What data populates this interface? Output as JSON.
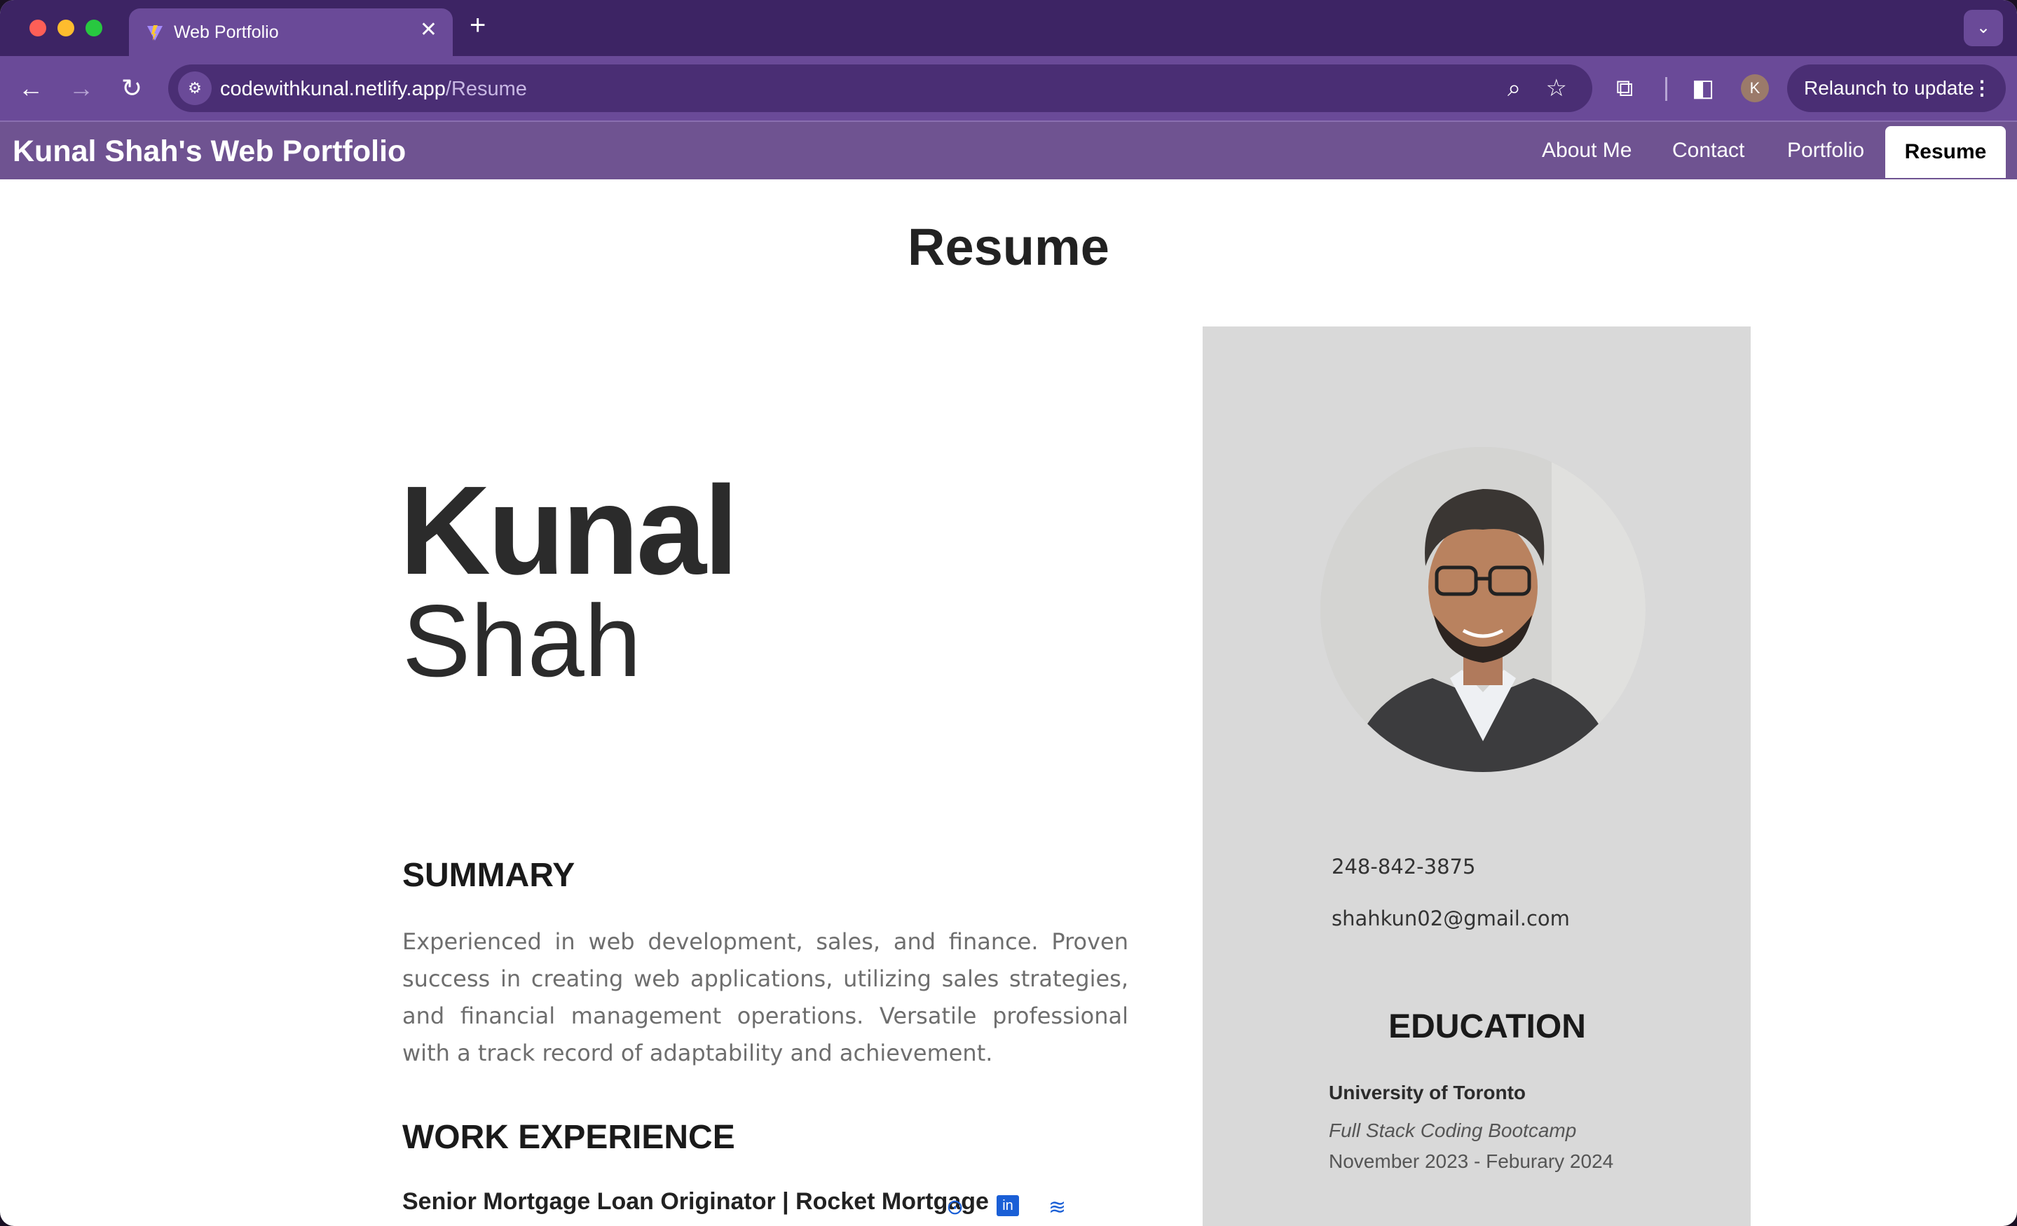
{
  "browser": {
    "tab_title": "Web Portfolio",
    "tab_close": "✕",
    "new_tab": "+",
    "tab_menu": "⌄",
    "url_host": "codewithkunal.netlify.app",
    "url_path": "/Resume",
    "avatar_letter": "K",
    "relaunch_label": "Relaunch to update",
    "relaunch_menu": "⋮"
  },
  "site": {
    "brand": "Kunal Shah's Web Portfolio",
    "nav": [
      {
        "label": "About Me"
      },
      {
        "label": "Contact"
      },
      {
        "label": "Portfolio"
      },
      {
        "label": "Resume",
        "active": true
      }
    ]
  },
  "page": {
    "title": "Resume",
    "first_name": "Kunal",
    "last_name": "Shah",
    "summary_heading": "SUMMARY",
    "summary_text": "Experienced in web development, sales, and finance. Proven success in creating web applications, utilizing sales strategies, and financial management operations. Versatile professional with a track record of adaptability and achievement.",
    "work_heading": "WORK EXPERIENCE",
    "job_title": "Senior Mortgage Loan Originator | Rocket Mortgage",
    "social_icons": [
      "github-icon",
      "linkedin-icon",
      "stackoverflow-icon"
    ]
  },
  "sidebar": {
    "phone": "248-842-3875",
    "email": "shahkun02@gmail.com",
    "education_heading": "EDUCATION",
    "school": "University of Toronto",
    "program": "Full Stack Coding Bootcamp",
    "dates": "November 2023 - Feburary 2024"
  },
  "colors": {
    "tabstrip": "#3d2464",
    "toolbar": "#6a4a98",
    "site_header": "#6f5391",
    "sidebar": "#d9d9d9",
    "social_accent": "#1a5fd6"
  }
}
